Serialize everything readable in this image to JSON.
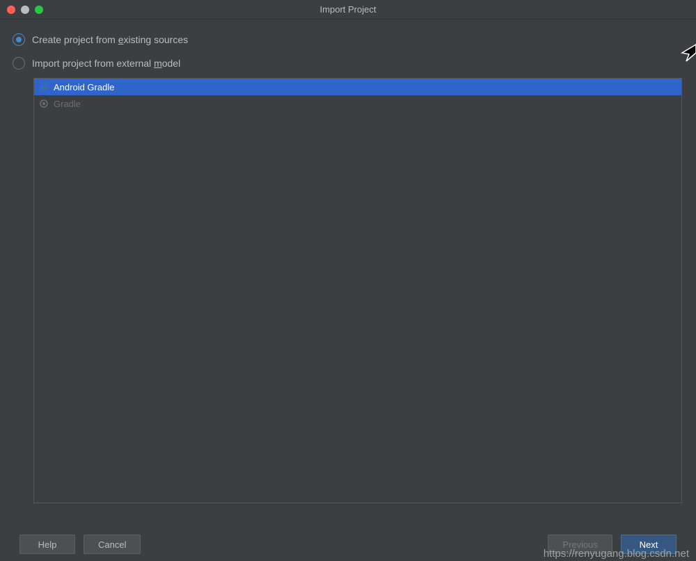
{
  "window": {
    "title": "Import Project"
  },
  "radios": {
    "existing_pre": "Create project from ",
    "existing_underline": "e",
    "existing_post": "xisting sources",
    "external_pre": "Import project from external ",
    "external_underline": "m",
    "external_post": "odel"
  },
  "models": {
    "android_gradle": "Android Gradle",
    "gradle": "Gradle"
  },
  "buttons": {
    "help": "Help",
    "cancel": "Cancel",
    "previous": "Previous",
    "next": "Next"
  },
  "watermark": "https://renyugang.blog.csdn.net"
}
